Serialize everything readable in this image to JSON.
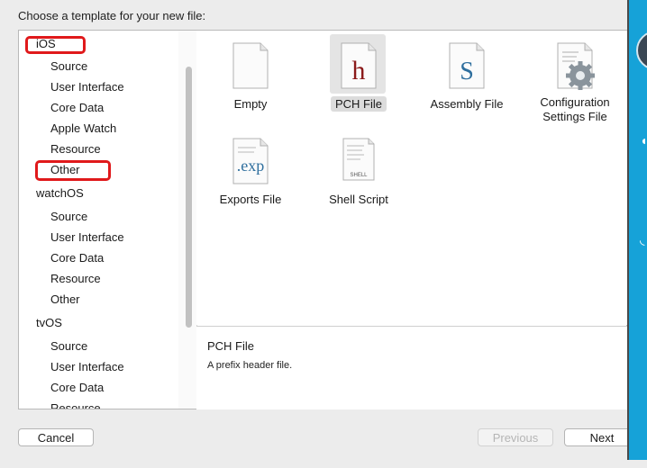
{
  "prompt": "Choose a template for your new file:",
  "sidebar": {
    "rows": [
      {
        "label": "iOS",
        "kind": "group"
      },
      {
        "label": "Source",
        "kind": "item"
      },
      {
        "label": "User Interface",
        "kind": "item"
      },
      {
        "label": "Core Data",
        "kind": "item"
      },
      {
        "label": "Apple Watch",
        "kind": "item"
      },
      {
        "label": "Resource",
        "kind": "item"
      },
      {
        "label": "Other",
        "kind": "item"
      },
      {
        "label": "watchOS",
        "kind": "group"
      },
      {
        "label": "Source",
        "kind": "item"
      },
      {
        "label": "User Interface",
        "kind": "item"
      },
      {
        "label": "Core Data",
        "kind": "item"
      },
      {
        "label": "Resource",
        "kind": "item"
      },
      {
        "label": "Other",
        "kind": "item"
      },
      {
        "label": "tvOS",
        "kind": "group"
      },
      {
        "label": "Source",
        "kind": "item"
      },
      {
        "label": "User Interface",
        "kind": "item"
      },
      {
        "label": "Core Data",
        "kind": "item"
      },
      {
        "label": "Resource",
        "kind": "item"
      }
    ]
  },
  "templates": [
    {
      "label": "Empty",
      "icon": "blank-document-icon",
      "selected": false
    },
    {
      "label": "PCH File",
      "icon": "pch-header-icon",
      "glyph": "h",
      "selected": true
    },
    {
      "label": "Assembly File",
      "icon": "assembly-file-icon",
      "glyph": "S",
      "selected": false
    },
    {
      "label": "Configuration Settings File",
      "label_line1": "Configuration",
      "label_line2": "Settings File",
      "icon": "gear-settings-icon",
      "selected": false
    },
    {
      "label": "Exports File",
      "icon": "exports-file-icon",
      "glyph": ".exp",
      "selected": false
    },
    {
      "label": "Shell Script",
      "icon": "shell-script-icon",
      "glyph": "SHELL",
      "selected": false
    }
  ],
  "description": {
    "title": "PCH File",
    "text": "A prefix header file."
  },
  "buttons": {
    "cancel": "Cancel",
    "previous": "Previous",
    "next": "Next"
  },
  "colors": {
    "accent_strip": "#16a2d8",
    "highlight_box": "#e0191b",
    "pch_glyph": "#8b1a1a",
    "assembly_glyph": "#2f6f9e"
  }
}
